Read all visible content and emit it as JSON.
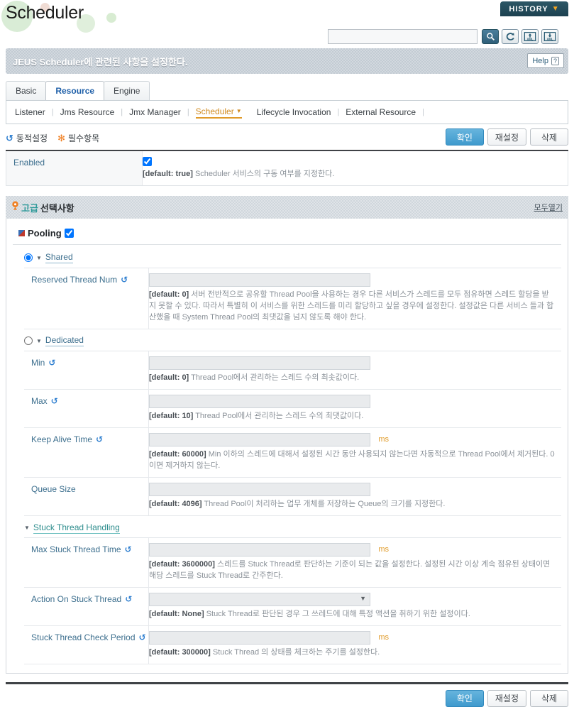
{
  "header": {
    "title": "Scheduler",
    "history_label": "HISTORY",
    "history_caret": "▼"
  },
  "search": {
    "value": "",
    "placeholder": "",
    "buttons": [
      {
        "name": "search-icon",
        "label": "🔍"
      },
      {
        "name": "refresh-icon",
        "label": "↺"
      },
      {
        "name": "xml-import-icon",
        "label": "XML"
      },
      {
        "name": "xml-export-icon",
        "label": "XML"
      }
    ]
  },
  "banner": {
    "description": "JEUS Scheduler에 관련된 사항을 설정한다.",
    "help_label": "Help",
    "help_mark": "?"
  },
  "tabs": [
    {
      "label": "Basic",
      "active": false
    },
    {
      "label": "Resource",
      "active": true
    },
    {
      "label": "Engine",
      "active": false
    }
  ],
  "subnav": {
    "items": [
      {
        "label": "Listener",
        "current": false
      },
      {
        "label": "Jms Resource",
        "current": false
      },
      {
        "label": "Jmx Manager",
        "current": false
      },
      {
        "label": "Scheduler",
        "current": true
      },
      {
        "label": "Lifecycle Invocation",
        "current": false
      },
      {
        "label": "External Resource",
        "current": false
      }
    ],
    "separator": "|",
    "caret": "▼"
  },
  "legend": {
    "dynamic_icon": "↺",
    "dynamic_label": "동적설정",
    "required_icon": "✻",
    "required_label": "필수항목"
  },
  "actions": {
    "ok": "확인",
    "reset": "재설정",
    "delete": "삭제"
  },
  "enabled_row": {
    "label": "Enabled",
    "checked": true,
    "default_text": "[default: true]",
    "hint": "Scheduler 서비스의 구동 여부를 지정한다."
  },
  "advanced": {
    "pin_icon": "📍",
    "title_accent": "고급",
    "title_rest": "선택사항",
    "open_all": "모두열기"
  },
  "pooling": {
    "label": "Pooling",
    "checked": true,
    "shared": {
      "label": "Shared",
      "selected": true,
      "fields": [
        {
          "label": "Reserved Thread Num",
          "dynamic": true,
          "type": "text",
          "value": "",
          "unit": "",
          "default_text": "[default: 0]",
          "hint": "서버 전반적으로 공유할 Thread Pool을 사용하는 경우 다른 서비스가 스레드를 모두 점유하면 스레드 할당을 받지 못할 수 있다. 따라서 특별히 이 서비스를 위한 스레드를 미리 할당하고 싶을 경우에 설정한다. 설정값은 다른 서비스 들과 합산했을 때 System Thread Pool의 최댓값을 넘지 않도록 해야 한다."
        }
      ]
    },
    "dedicated": {
      "label": "Dedicated",
      "selected": false,
      "fields": [
        {
          "label": "Min",
          "dynamic": true,
          "type": "text",
          "value": "",
          "unit": "",
          "default_text": "[default: 0]",
          "hint": "Thread Pool에서 관리하는 스레드 수의 최솟값이다."
        },
        {
          "label": "Max",
          "dynamic": true,
          "type": "text",
          "value": "",
          "unit": "",
          "default_text": "[default: 10]",
          "hint": "Thread Pool에서 관리하는 스레드 수의 최댓값이다."
        },
        {
          "label": "Keep Alive Time",
          "dynamic": true,
          "type": "text",
          "value": "",
          "unit": "ms",
          "default_text": "[default: 60000]",
          "hint": "Min 이하의 스레드에 대해서 설정된 시간 동안 사용되지 않는다면 자동적으로 Thread Pool에서 제거된다. 0이면 제거하지 않는다."
        },
        {
          "label": "Queue Size",
          "dynamic": false,
          "type": "text",
          "value": "",
          "unit": "",
          "default_text": "[default: 4096]",
          "hint": "Thread Pool이 처리하는 업무 개체를 저장하는 Queue의 크기를 지정한다."
        }
      ]
    },
    "stuck": {
      "label": "Stuck Thread Handling",
      "fields": [
        {
          "label": "Max Stuck Thread Time",
          "dynamic": true,
          "type": "text",
          "value": "",
          "unit": "ms",
          "default_text": "[default: 3600000]",
          "hint": "스레드를 Stuck Thread로 판단하는 기준이 되는 값을 설정한다. 설정된 시간 이상 계속 점유된 상태이면 해당 스레드를 Stuck Thread로 간주한다."
        },
        {
          "label": "Action On Stuck Thread",
          "dynamic": true,
          "type": "select",
          "value": "",
          "unit": "",
          "default_text": "[default: None]",
          "hint": "Stuck Thread로 판단된 경우 그 쓰레드에 대해 특정 액션을 취하기 위한 설정이다."
        },
        {
          "label": "Stuck Thread Check Period",
          "dynamic": true,
          "type": "text",
          "value": "",
          "unit": "ms",
          "default_text": "[default: 300000]",
          "hint": "Stuck Thread 의 상태를 체크하는 주기를 설정한다."
        }
      ]
    }
  },
  "colors": {
    "accent_blue": "#3d6f8e",
    "accent_orange": "#e09a28",
    "accent_teal": "#2e8d8d",
    "ok_button": "#3f9acd"
  }
}
